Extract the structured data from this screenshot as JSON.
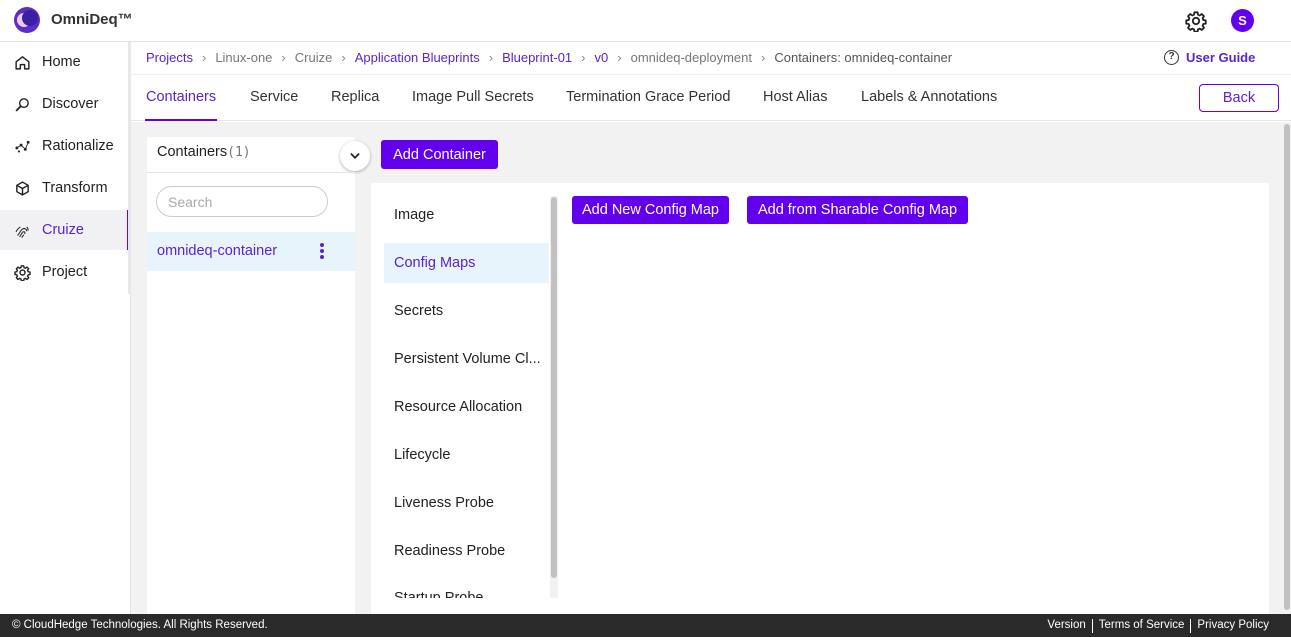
{
  "app": {
    "brand": "OmniDeq™"
  },
  "header": {
    "avatar_initial": "S",
    "settings_icon": "gear-icon"
  },
  "sidebar": {
    "items": [
      {
        "label": "Home",
        "icon": "home-icon",
        "active": false
      },
      {
        "label": "Discover",
        "icon": "magnifier-icon",
        "active": false
      },
      {
        "label": "Rationalize",
        "icon": "scatter-icon",
        "active": false
      },
      {
        "label": "Transform",
        "icon": "cube-icon",
        "active": false
      },
      {
        "label": "Cruize",
        "icon": "fingerprint-icon",
        "active": true
      },
      {
        "label": "Project",
        "icon": "gear-icon",
        "active": false
      }
    ]
  },
  "breadcrumb": {
    "items": [
      "Projects",
      "Linux-one",
      "Cruize",
      "Application Blueprints",
      "Blueprint-01",
      "v0",
      "omnideq-deployment",
      "Containers: omnideq-container"
    ]
  },
  "user_guide": {
    "label": "User Guide"
  },
  "tabs": {
    "items": [
      "Containers",
      "Service",
      "Replica",
      "Image Pull Secrets",
      "Termination Grace Period",
      "Host Alias",
      "Labels & Annotations"
    ],
    "active": "Containers",
    "back_label": "Back"
  },
  "containers_panel": {
    "title": "Containers",
    "count": "(1)",
    "search_placeholder": "Search",
    "items": [
      "omnideq-container"
    ]
  },
  "add_container_label": "Add Container",
  "sections": {
    "items": [
      "Image",
      "Config Maps",
      "Secrets",
      "Persistent Volume Cl...",
      "Resource Allocation",
      "Lifecycle",
      "Liveness Probe",
      "Readiness Probe",
      "Startup Probe"
    ],
    "active": "Config Maps"
  },
  "config_maps": {
    "add_new_label": "Add New Config Map",
    "add_sharable_label": "Add from Sharable Config Map"
  },
  "footer": {
    "copyright": "© CloudHedge Technologies. All Rights Reserved.",
    "links": [
      "Version",
      "Terms of Service",
      "Privacy Policy"
    ]
  },
  "colors": {
    "accent": "#6200ee",
    "accent_text": "#5b21d4",
    "selected_bg": "#e8f4fb"
  }
}
